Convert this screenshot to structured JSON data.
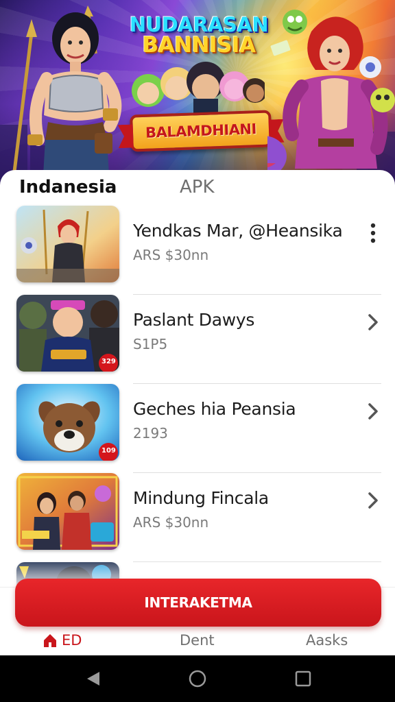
{
  "banner": {
    "title_line1": "NUDARASAN",
    "title_line2": "BANNISIA",
    "ribbon_text": "BALAMDHIANI"
  },
  "tabs": [
    {
      "label": "Indanesia",
      "active": true
    },
    {
      "label": "APK",
      "active": false
    }
  ],
  "list": {
    "items": [
      {
        "title": "Yendkas Mar, @Heansika",
        "subtitle": "ARS $30nn",
        "action_icon": "more-vertical-icon",
        "badge": ""
      },
      {
        "title": "Paslant Dawys",
        "subtitle": "S1P5",
        "action_icon": "chevron-right-icon",
        "badge": "329"
      },
      {
        "title": "Geches hia Peansia",
        "subtitle": "2193",
        "action_icon": "chevron-right-icon",
        "badge": "109"
      },
      {
        "title": "Mindung Fincala",
        "subtitle": "ARS $30nn",
        "action_icon": "chevron-right-icon",
        "badge": ""
      },
      {
        "title": "",
        "subtitle": "",
        "action_icon": "",
        "badge": ""
      }
    ]
  },
  "cta": {
    "label": "INTERAKETMA"
  },
  "bottom_nav": [
    {
      "label": "ED",
      "icon": "house-icon",
      "active": true
    },
    {
      "label": "Dent",
      "active": false
    },
    {
      "label": "Aasks",
      "active": false
    }
  ],
  "colors": {
    "accent": "#c9151b",
    "text": "#1c1c1c",
    "muted": "#7a7a7a"
  }
}
